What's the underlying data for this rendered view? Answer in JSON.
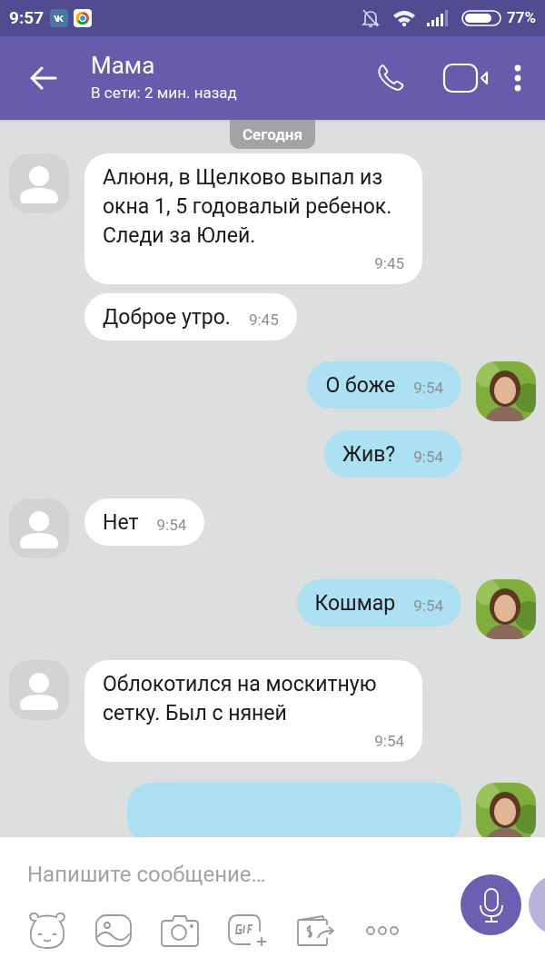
{
  "status_bar": {
    "time": "9:57",
    "battery": "77%"
  },
  "header": {
    "title": "Мама",
    "subtitle": "В сети: 2 мин. назад"
  },
  "date_badge": "Сегодня",
  "messages": [
    {
      "outgoing": false,
      "kind": "text",
      "text": "Алюня, в Щелково выпал из окна 1, 5 годовалый ребенок. Следи за Юлей.",
      "time": "9:45",
      "avatar": true
    },
    {
      "outgoing": false,
      "kind": "text",
      "text": "Доброе утро.",
      "time": "9:45",
      "avatar": false
    },
    {
      "outgoing": true,
      "kind": "text",
      "text": "О боже",
      "time": "9:54",
      "avatar": true
    },
    {
      "outgoing": true,
      "kind": "text",
      "text": "Жив?",
      "time": "9:54",
      "avatar": false
    },
    {
      "outgoing": false,
      "kind": "text",
      "text": "Нет",
      "time": "9:54",
      "avatar": true
    },
    {
      "outgoing": true,
      "kind": "text",
      "text": "Кошмар",
      "time": "9:54",
      "avatar": true
    },
    {
      "outgoing": false,
      "kind": "text",
      "text": "Облокотился на москитную сетку. Был с няней",
      "time": "9:54",
      "avatar": true
    },
    {
      "outgoing": true,
      "kind": "cut",
      "avatar": true
    }
  ],
  "composer": {
    "placeholder": "Напишите сообщение…"
  }
}
